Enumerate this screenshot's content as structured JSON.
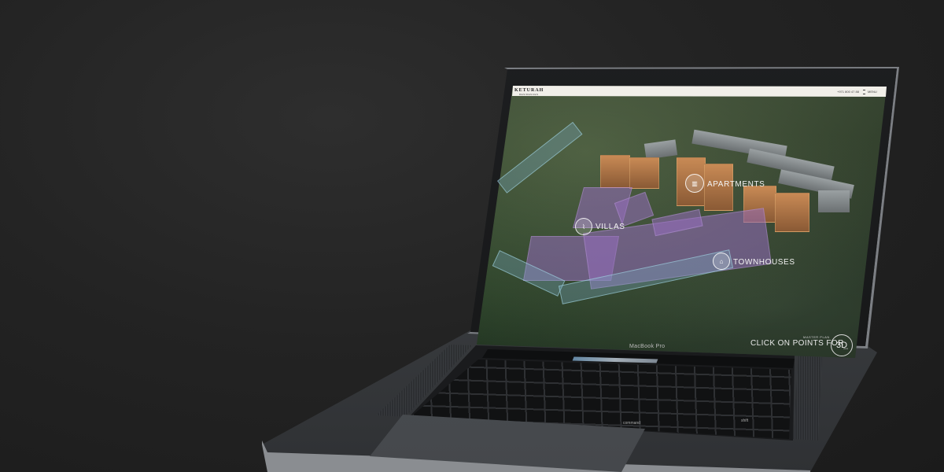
{
  "site": {
    "brand": "KETURAH",
    "brand_sub": "RESIDENCES",
    "phone": "+971 800 47 88",
    "menu_label": "MENU"
  },
  "hotspots": {
    "apartments": "APARTMENTS",
    "villas": "VILLAS",
    "townhouses": "TOWNHOUSES"
  },
  "cta": {
    "master_plan": "MASTER PLAN",
    "click_text": "CLICK ON POINTS FOR",
    "three_d": "3D",
    "three_d_sub": "view"
  },
  "device": {
    "model_label": "MacBook Pro",
    "keys": [
      "command",
      "command",
      "option",
      "shift",
      "enter"
    ]
  },
  "colors": {
    "background": "#232323",
    "tower": "#c88a55",
    "villa": "#9a6ec0",
    "townhouse": "#78aabe"
  }
}
